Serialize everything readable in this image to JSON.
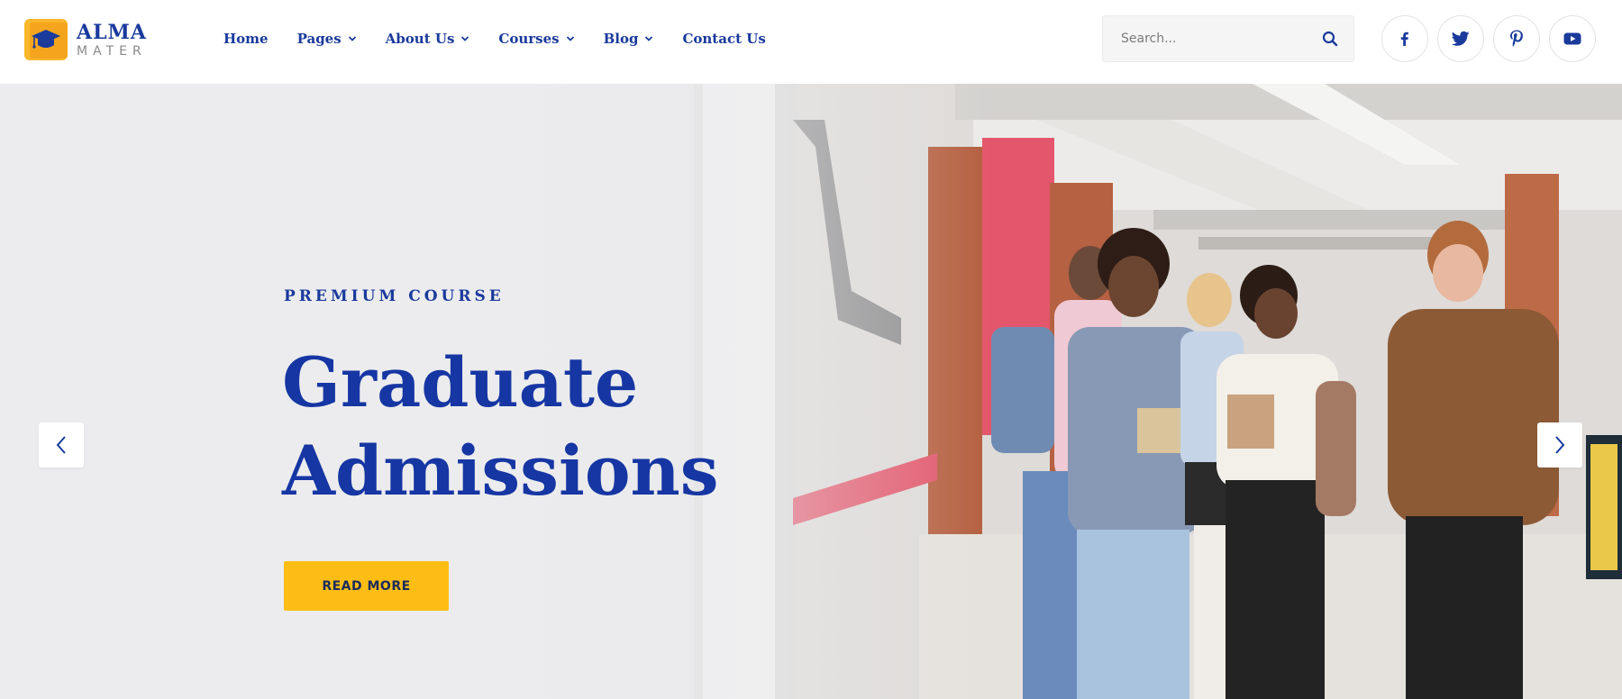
{
  "brand": {
    "name_top": "ALMA",
    "name_bottom": "MATER",
    "logo_icon": "graduation-cap-icon"
  },
  "nav": {
    "items": [
      {
        "label": "Home",
        "has_dropdown": false
      },
      {
        "label": "Pages",
        "has_dropdown": true
      },
      {
        "label": "About Us",
        "has_dropdown": true
      },
      {
        "label": "Courses",
        "has_dropdown": true
      },
      {
        "label": "Blog",
        "has_dropdown": true
      },
      {
        "label": "Contact Us",
        "has_dropdown": false
      }
    ]
  },
  "search": {
    "placeholder": "Search...",
    "value": "",
    "icon": "search-icon"
  },
  "socials": [
    {
      "name": "facebook",
      "icon": "facebook-icon"
    },
    {
      "name": "twitter",
      "icon": "twitter-icon"
    },
    {
      "name": "pinterest",
      "icon": "pinterest-icon"
    },
    {
      "name": "youtube",
      "icon": "youtube-icon"
    }
  ],
  "hero": {
    "eyebrow": "PREMIUM COURSE",
    "title_line1": "Graduate",
    "title_line2": "Admissions",
    "cta_label": "READ MORE",
    "prev_icon": "chevron-left-icon",
    "next_icon": "chevron-right-icon"
  },
  "colors": {
    "primary": "#1a3a9c",
    "accent": "#fdbd14",
    "logo": "#f9b72b"
  }
}
